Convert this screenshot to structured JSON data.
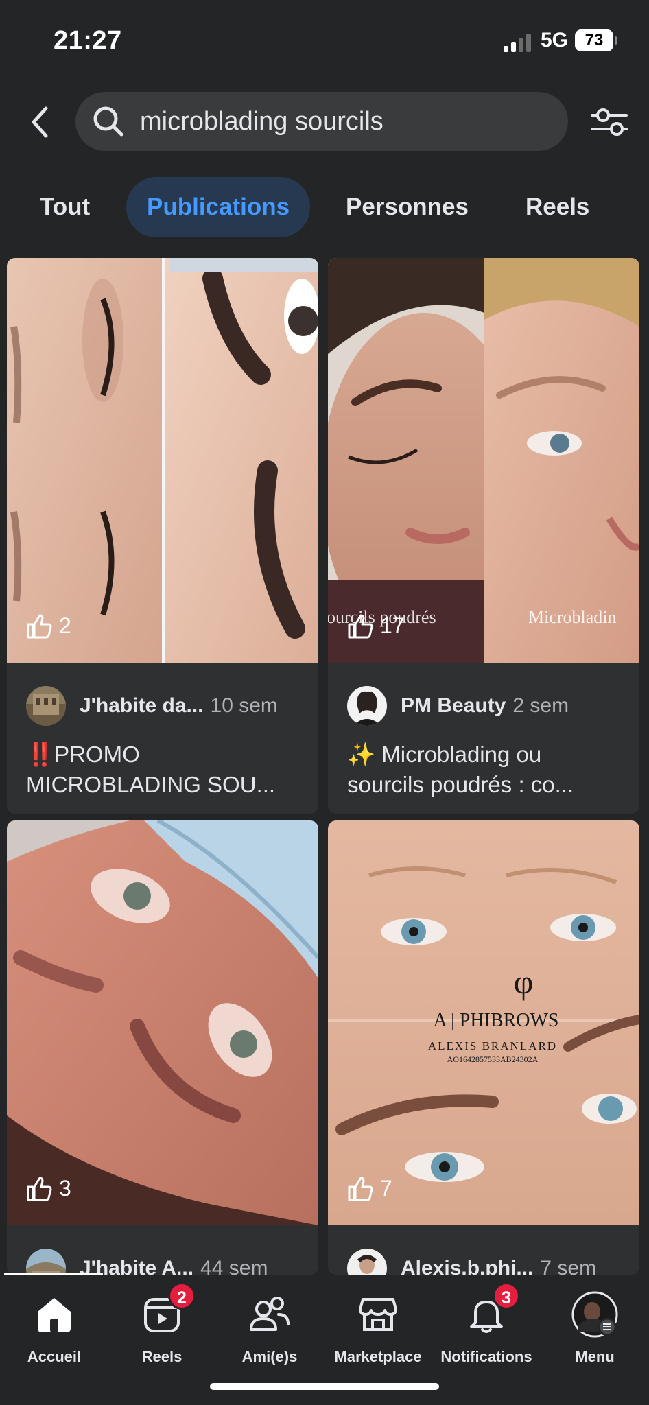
{
  "status_bar": {
    "time": "21:27",
    "network": "5G",
    "battery": "73"
  },
  "search": {
    "query": "microblading sourcils"
  },
  "tabs": [
    {
      "label": "Tout"
    },
    {
      "label": "Publications"
    },
    {
      "label": "Personnes"
    },
    {
      "label": "Reels"
    }
  ],
  "posts": [
    {
      "likes": "2",
      "author": "J'habite da...",
      "age": "10 sem",
      "caption_line1": "‼️PROMO",
      "caption_line2": "MICROBLADING SOU...",
      "overlay_text": ""
    },
    {
      "likes": "17",
      "author": "PM Beauty",
      "age": "2 sem",
      "caption_line1": "✨ Microblading ou",
      "caption_line2": "sourcils poudrés : co...",
      "overlay_text": "ourcils poudrés",
      "overlay_text2": "Microbladin"
    },
    {
      "likes": "3",
      "author": "J'habite A...",
      "age": "44 sem",
      "caption_line1": "",
      "caption_line2": "",
      "overlay_text": ""
    },
    {
      "likes": "7",
      "author": "Alexis.b.phi...",
      "age": "7 sem",
      "caption_line1": "",
      "caption_line2": "",
      "overlay_text": "A | PHIBROWS",
      "overlay_text2": "ALEXIS BRANLARD",
      "overlay_text3": "AO1642857533AB24302A"
    }
  ],
  "bottom_nav": [
    {
      "label": "Accueil",
      "icon": "home-icon",
      "badge": ""
    },
    {
      "label": "Reels",
      "icon": "reels-icon",
      "badge": "2"
    },
    {
      "label": "Ami(e)s",
      "icon": "friends-icon",
      "badge": ""
    },
    {
      "label": "Marketplace",
      "icon": "marketplace-icon",
      "badge": ""
    },
    {
      "label": "Notifications",
      "icon": "bell-icon",
      "badge": "3"
    },
    {
      "label": "Menu",
      "icon": "profile-avatar",
      "badge": ""
    }
  ],
  "colors": {
    "background": "#242526",
    "accent": "#4599ff",
    "active_tab_bg": "#263951",
    "badge": "#e41e3f"
  }
}
